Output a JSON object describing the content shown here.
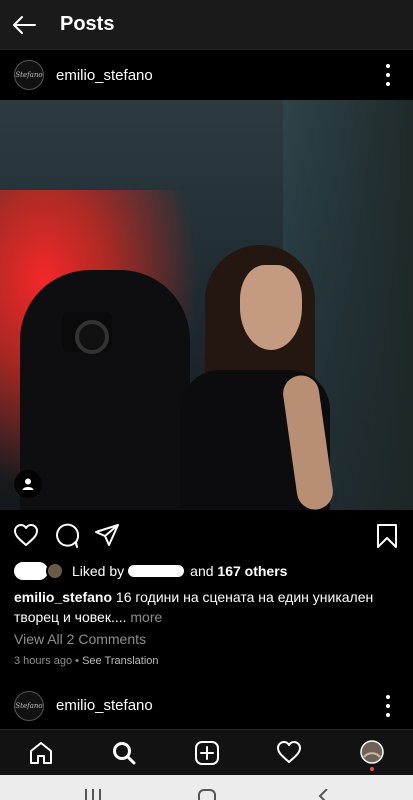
{
  "header": {
    "title": "Posts"
  },
  "post": {
    "username": "emilio_stefano",
    "avatar_logo_text": "Stefano",
    "likes": {
      "prefix": "Liked by",
      "and_text": "and",
      "others": "167 others"
    },
    "caption": {
      "username": "emilio_stefano",
      "text": "16 години на сцената на един уникален творец и човек....",
      "more": "more"
    },
    "view_comments": "View All 2 Comments",
    "time": "3 hours ago",
    "separator": "•",
    "translate": "See Translation"
  },
  "post2": {
    "username": "emilio_stefano"
  },
  "colors": {
    "background": "#000000",
    "notification_dot": "#ed4956",
    "secondary_text": "#8e8e8e"
  },
  "icons": {
    "back": "arrow-left-icon",
    "more": "more-vertical-icon",
    "like": "heart-icon",
    "comment": "comment-icon",
    "share": "send-icon",
    "save": "bookmark-icon",
    "tag": "person-icon",
    "home": "home-icon",
    "search": "search-icon",
    "add": "add-post-icon",
    "activity": "heart-icon",
    "profile": "profile-avatar-icon"
  }
}
